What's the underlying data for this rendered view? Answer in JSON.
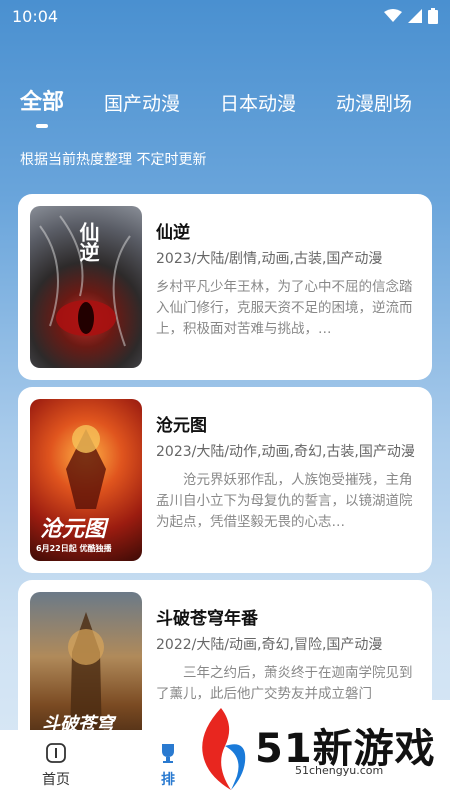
{
  "status_bar": {
    "time": "10:04"
  },
  "tabs": [
    {
      "label": "全部",
      "active": true
    },
    {
      "label": "国产动漫",
      "active": false
    },
    {
      "label": "日本动漫",
      "active": false
    },
    {
      "label": "动漫剧场",
      "active": false
    }
  ],
  "subtitle": "根据当前热度整理 不定时更新",
  "cards": [
    {
      "title": "仙逆",
      "meta": "2023/大陆/剧情,动画,古装,国产动漫",
      "desc": "乡村平凡少年王林，为了心中不屈的信念踏入仙门修行，克服天资不足的困境，逆流而上，积极面对苦难与挑战，…",
      "poster_text": "仙逆"
    },
    {
      "title": "沧元图",
      "meta": "2023/大陆/动作,动画,奇幻,古装,国产动漫",
      "desc": "沧元界妖邪作乱，人族饱受摧残，主角孟川自小立下为母复仇的誓言，以镜湖道院为起点，凭借坚毅无畏的心志…",
      "poster_text": "沧元图",
      "poster_date": "6月22日起 优酷独播"
    },
    {
      "title": "斗破苍穹年番",
      "meta": "2022/大陆/动画,奇幻,冒险,国产动漫",
      "desc": "三年之约后，萧炎终于在迦南学院见到了薰儿，此后他广交势友并成立磐门",
      "poster_text": "斗破苍穹"
    }
  ],
  "bottom_nav": [
    {
      "label": "首页",
      "icon": "home-icon",
      "active": false
    },
    {
      "label": "排",
      "icon": "trophy-icon",
      "active": true
    }
  ],
  "watermark": {
    "brand": "51新游戏",
    "url": "51chengyu.com"
  },
  "colors": {
    "accent": "#2a7ad0",
    "bg_top": "#4a90d0",
    "bg_bottom": "#dbe9f6"
  }
}
